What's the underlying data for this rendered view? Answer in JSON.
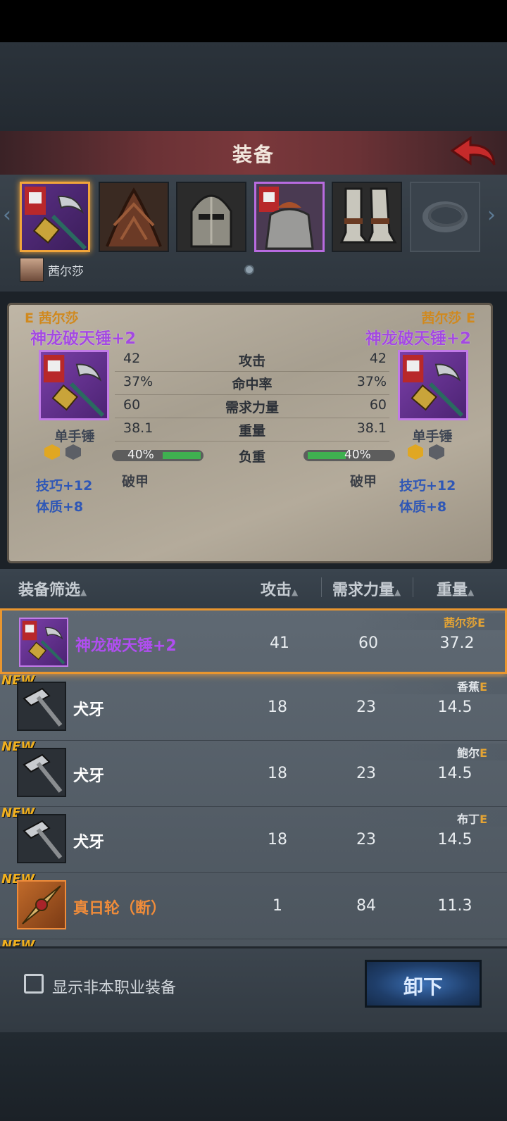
{
  "header": {
    "title": "装备"
  },
  "slots": [
    {
      "name": "slot-weapon",
      "icon": "hammer-icon",
      "selected": true
    },
    {
      "name": "slot-cloak",
      "icon": "root-armor-icon"
    },
    {
      "name": "slot-helmet",
      "icon": "helmet-icon"
    },
    {
      "name": "slot-body",
      "icon": "chainmail-icon"
    },
    {
      "name": "slot-boots",
      "icon": "greaves-icon"
    },
    {
      "name": "slot-ring",
      "icon": "ring-icon",
      "empty": true
    }
  ],
  "character": {
    "name": "茜尔莎"
  },
  "compare": {
    "left": {
      "owner": "E 茜尔莎",
      "item_name": "神龙破天锤+2",
      "type": "单手锤",
      "attack": "42",
      "hit": "37%",
      "str": "60",
      "weight": "38.1",
      "load": "40%",
      "load_fraction": 0.4,
      "armor": "破甲",
      "bonus1": "技巧+12",
      "bonus2": "体质+8"
    },
    "right": {
      "owner": "茜尔莎 E",
      "item_name": "神龙破天锤+2",
      "type": "单手锤",
      "attack": "42",
      "hit": "37%",
      "str": "60",
      "weight": "38.1",
      "load": "40%",
      "load_fraction": 0.4,
      "armor": "破甲",
      "bonus1": "技巧+12",
      "bonus2": "体质+8"
    },
    "labels": {
      "attack": "攻击",
      "hit": "命中率",
      "str": "需求力量",
      "weight": "重量",
      "load": "负重"
    }
  },
  "list_header": {
    "filter": "装备筛选",
    "attack": "攻击",
    "str": "需求力量",
    "weight": "重量"
  },
  "rows": [
    {
      "name": "神龙破天锤+2",
      "attack": "41",
      "str": "60",
      "weight": "37.2",
      "owner": "茜尔莎",
      "owner_tag": "E"
    },
    {
      "new": "NEW",
      "name": "犬牙",
      "attack": "18",
      "str": "23",
      "weight": "14.5",
      "owner": "香蕉",
      "owner_tag": "E"
    },
    {
      "new": "NEW",
      "name": "犬牙",
      "attack": "18",
      "str": "23",
      "weight": "14.5",
      "owner": "鲍尔",
      "owner_tag": "E"
    },
    {
      "new": "NEW",
      "name": "犬牙",
      "attack": "18",
      "str": "23",
      "weight": "14.5",
      "owner": "布丁",
      "owner_tag": "E"
    },
    {
      "new": "NEW",
      "name": "真日轮（断）",
      "attack": "1",
      "str": "84",
      "weight": "11.3"
    },
    {
      "new": "NEW"
    }
  ],
  "footer": {
    "checkbox_label": "显示非本职业装备",
    "unequip": "卸下"
  }
}
